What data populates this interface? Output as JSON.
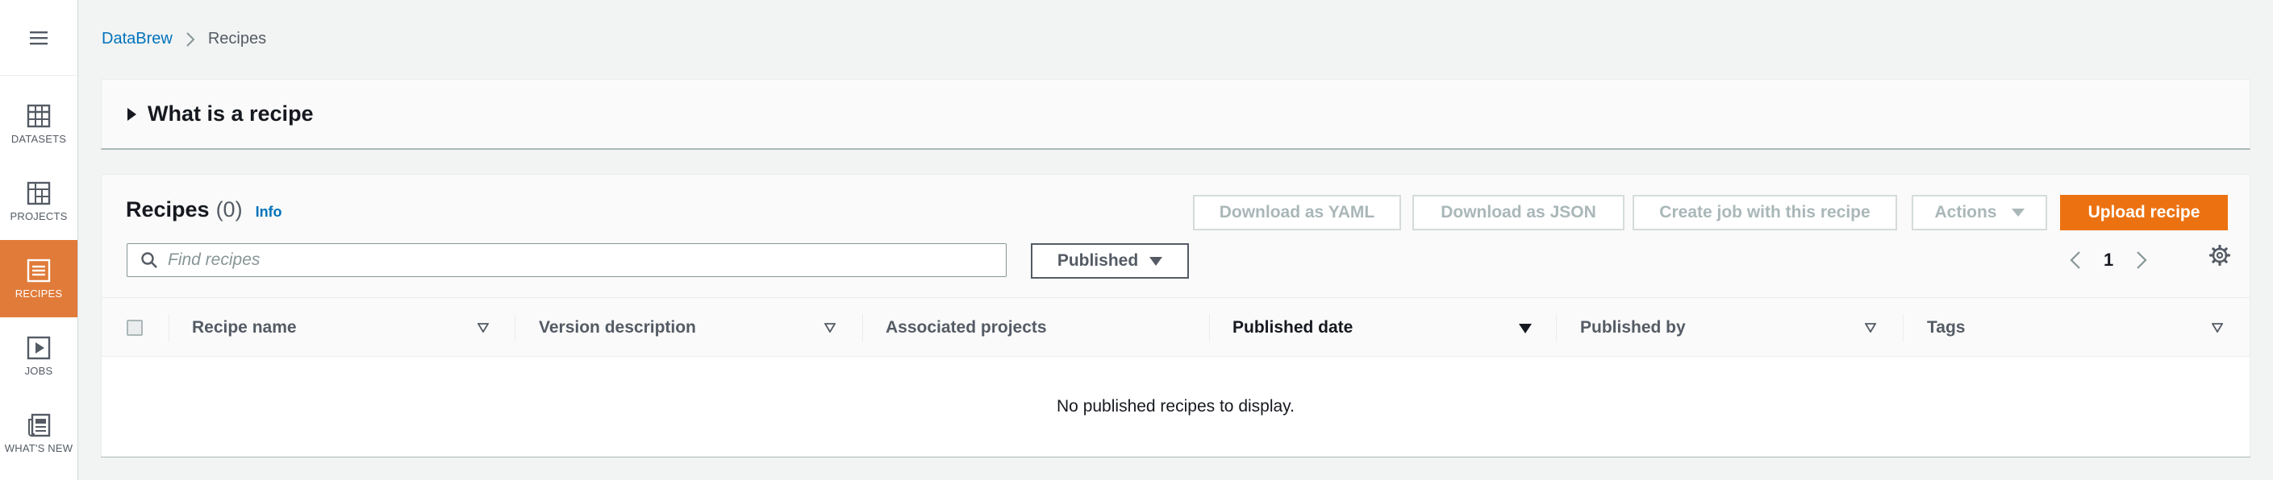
{
  "nav": {
    "menu_icon": "hamburger-icon",
    "items": [
      {
        "label": "DATASETS",
        "icon": "table-icon",
        "active": false
      },
      {
        "label": "PROJECTS",
        "icon": "grid-icon",
        "active": false
      },
      {
        "label": "RECIPES",
        "icon": "recipe-icon",
        "active": true
      },
      {
        "label": "JOBS",
        "icon": "play-icon",
        "active": false
      },
      {
        "label": "WHAT'S NEW",
        "icon": "newspaper-icon",
        "active": false
      }
    ]
  },
  "breadcrumb": {
    "root": "DataBrew",
    "current": "Recipes"
  },
  "info_panel": {
    "title": "What is a recipe"
  },
  "recipes": {
    "title": "Recipes",
    "count": "(0)",
    "info": "Info",
    "buttons": {
      "download_yaml": "Download as YAML",
      "download_json": "Download as JSON",
      "create_job": "Create job with this recipe",
      "actions": "Actions",
      "upload": "Upload recipe"
    },
    "search": {
      "placeholder": "Find recipes",
      "value": ""
    },
    "filter": {
      "selected": "Published"
    },
    "pagination": {
      "page": "1"
    },
    "columns": [
      "Recipe name",
      "Version description",
      "Associated projects",
      "Published date",
      "Published by",
      "Tags"
    ],
    "empty_message": "No published recipes to display."
  },
  "colors": {
    "accent": "#ec7211",
    "nav_active": "#e07b39",
    "link": "#0073bb"
  }
}
